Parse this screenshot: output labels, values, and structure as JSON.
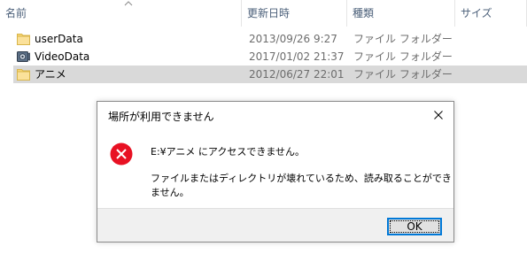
{
  "columns": {
    "name": "名前",
    "date": "更新日時",
    "type": "種類",
    "size": "サイズ"
  },
  "files": [
    {
      "name": "userData",
      "date": "2013/09/26 9:27",
      "type": "ファイル フォルダー",
      "icon": "folder-icon"
    },
    {
      "name": "VideoData",
      "date": "2017/01/02 21:37",
      "type": "ファイル フォルダー",
      "icon": "video-folder-icon"
    },
    {
      "name": "アニメ",
      "date": "2012/06/27 22:01",
      "type": "ファイル フォルダー",
      "icon": "folder-icon"
    }
  ],
  "dialog": {
    "title": "場所が利用できません",
    "message_line1": "E:¥アニメ にアクセスできません。",
    "message_line2": "ファイルまたはディレクトリが壊れているため、読み取ることができません。",
    "ok_label": "OK",
    "icon": "error-icon"
  },
  "colors": {
    "folder": "#f8d775",
    "selected_row": "#d9d9d9",
    "error_red": "#e81123",
    "focus_blue": "#0078d7"
  }
}
